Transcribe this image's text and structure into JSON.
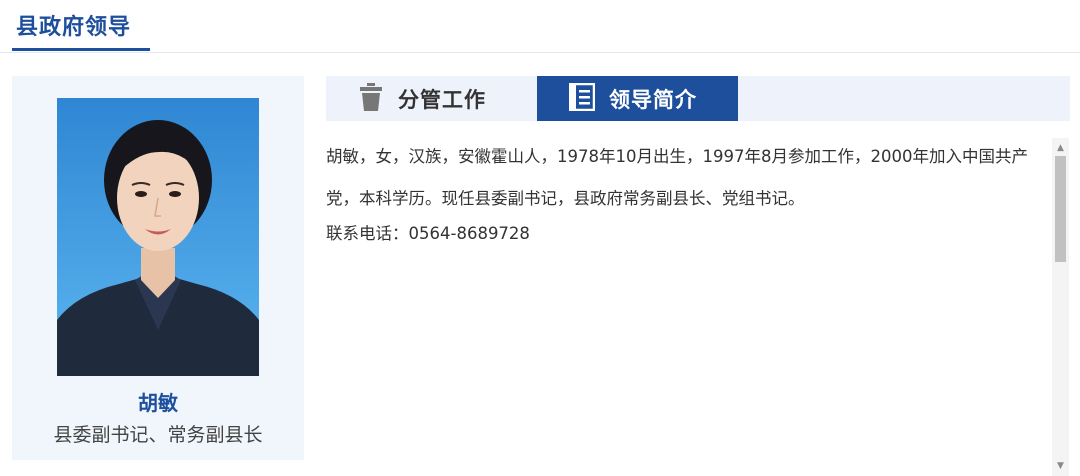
{
  "header": {
    "title": "县政府领导"
  },
  "profile": {
    "name": "胡敏",
    "position": "县委副书记、常务副县长"
  },
  "tabs": [
    {
      "label": "分管工作",
      "icon": "trash-bin-icon",
      "active": false
    },
    {
      "label": "领导简介",
      "icon": "document-list-icon",
      "active": true
    }
  ],
  "bio": {
    "text": "胡敏，女，汉族，安徽霍山人，1978年10月出生，1997年8月参加工作，2000年加入中国共产党，本科学历。现任县委副书记，县政府常务副县长、党组书记。",
    "contact": "联系电话：0564-8689728"
  },
  "colors": {
    "brand": "#1d4f9c",
    "panel_bg": "#f1f6fd",
    "tab_bar_bg": "#eef3fb"
  }
}
